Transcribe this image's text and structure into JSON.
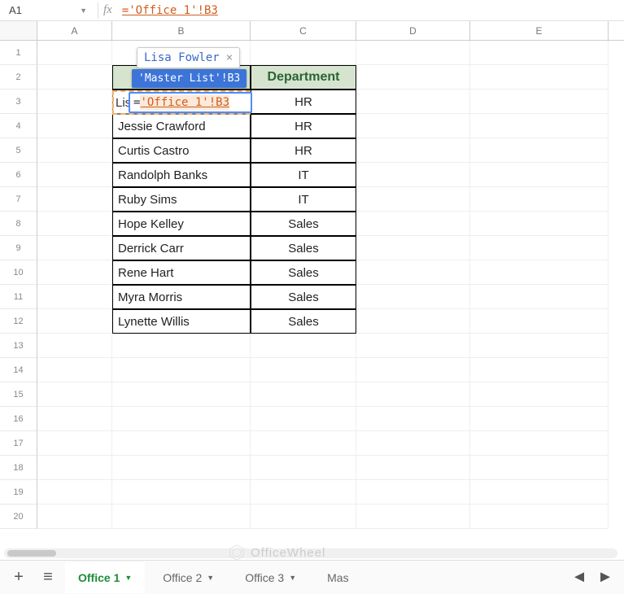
{
  "name_box": "A1",
  "formula": "='Office 1'!B3",
  "columns": [
    "A",
    "B",
    "C",
    "D",
    "E"
  ],
  "row_count": 20,
  "table": {
    "headers": {
      "b": "",
      "c": "Department"
    },
    "rows": [
      {
        "name": "Lisa Fowler",
        "dept": "HR"
      },
      {
        "name": "Jessie Crawford",
        "dept": "HR"
      },
      {
        "name": "Curtis Castro",
        "dept": "HR"
      },
      {
        "name": "Randolph Banks",
        "dept": "IT"
      },
      {
        "name": "Ruby Sims",
        "dept": "IT"
      },
      {
        "name": "Hope Kelley",
        "dept": "Sales"
      },
      {
        "name": "Derrick Carr",
        "dept": "Sales"
      },
      {
        "name": "Rene Hart",
        "dept": "Sales"
      },
      {
        "name": "Myra Morris",
        "dept": "Sales"
      },
      {
        "name": "Lynette Willis",
        "dept": "Sales"
      }
    ]
  },
  "edit": {
    "phantom": "Lis",
    "eq": "=",
    "ref": "'Office 1'!B3",
    "suggestion": "Lisa Fowler",
    "tooltip": "'Master List'!B3"
  },
  "sheets": {
    "active": "Office 1",
    "others": [
      "Office 2",
      "Office 3",
      "Mas"
    ]
  },
  "watermark": "OfficeWheel"
}
